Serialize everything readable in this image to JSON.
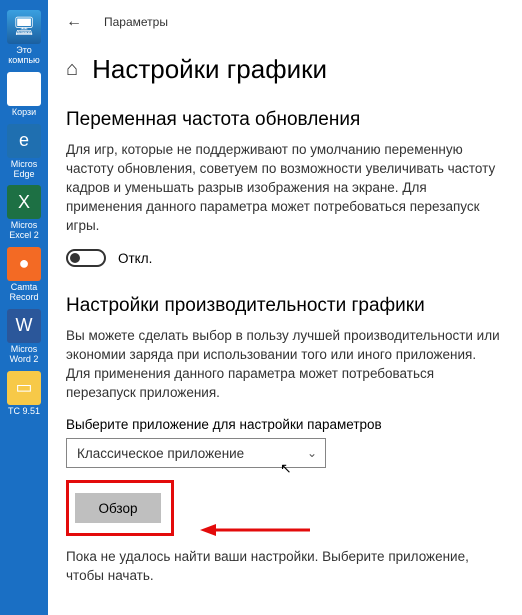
{
  "desktop": {
    "icons": [
      {
        "name": "pc",
        "label": "Это\nкомпью"
      },
      {
        "name": "bin",
        "label": "Корзи"
      },
      {
        "name": "edge",
        "label": "Micros\nEdge"
      },
      {
        "name": "excel",
        "label": "Micros\nExcel 2"
      },
      {
        "name": "camt",
        "label": "Camta\nRecord"
      },
      {
        "name": "word",
        "label": "Micros\nWord 2"
      },
      {
        "name": "tc",
        "label": "TC 9.51"
      }
    ]
  },
  "header": {
    "app_title": "Параметры",
    "page_title": "Настройки графики"
  },
  "vrr": {
    "title": "Переменная частота обновления",
    "desc": "Для игр, которые не поддерживают по умолчанию переменную частоту обновления, советуем по возможности увеличивать частоту кадров и уменьшать разрыв изображения на экране. Для применения данного параметра может потребоваться перезапуск игры.",
    "toggle_label": "Откл.",
    "toggle_on": false
  },
  "perf": {
    "title": "Настройки производительности графики",
    "desc": "Вы можете сделать выбор в пользу лучшей производительности или экономии заряда при использовании того или иного приложения. Для применения данного параметра может потребоваться перезапуск приложения.",
    "field_label": "Выберите приложение для настройки параметров",
    "dropdown_value": "Классическое приложение",
    "browse_label": "Обзор",
    "status": "Пока не удалось найти ваши настройки. Выберите приложение, чтобы начать."
  }
}
